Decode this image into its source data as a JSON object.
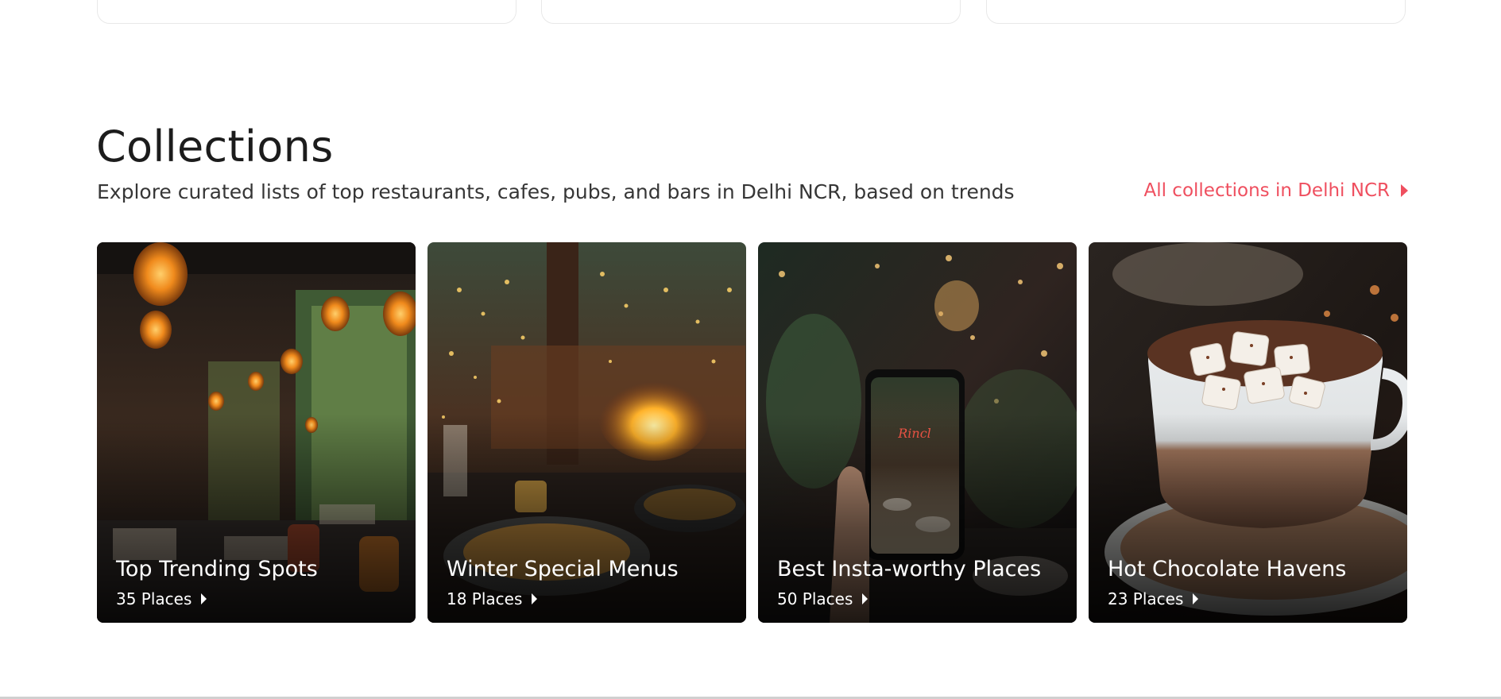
{
  "section": {
    "title": "Collections",
    "subtitle": "Explore curated lists of top restaurants, cafes, pubs, and bars in Delhi NCR, based on trends",
    "all_link": "All collections in Delhi NCR"
  },
  "collections": [
    {
      "title": "Top Trending Spots",
      "count": "35 Places",
      "image": "restaurant-interior-with-hanging-lanterns"
    },
    {
      "title": "Winter Special Menus",
      "count": "18 Places",
      "image": "dinner-table-with-fireplace"
    },
    {
      "title": "Best Insta-worthy Places",
      "count": "50 Places",
      "image": "phone-photographing-restaurant"
    },
    {
      "title": "Hot Chocolate Havens",
      "count": "23 Places",
      "image": "hot-chocolate-with-marshmallows"
    }
  ],
  "colors": {
    "accent": "#ef4f5f",
    "heading": "#1c1c1c",
    "subtext": "#363636"
  }
}
